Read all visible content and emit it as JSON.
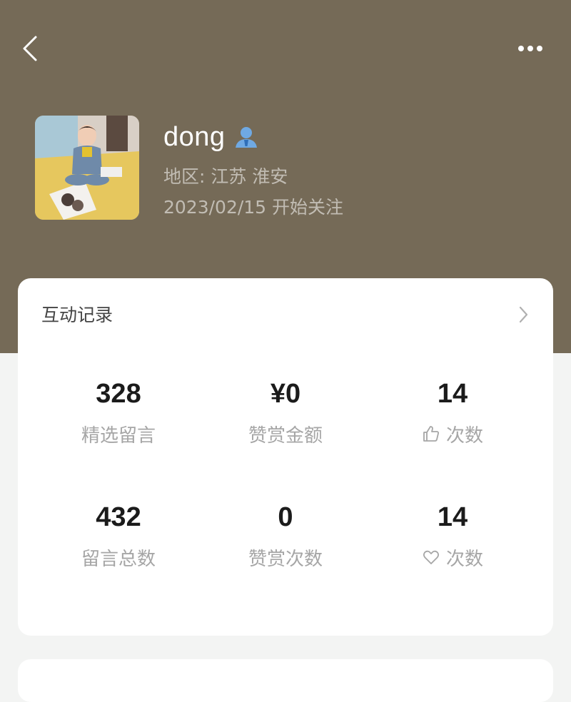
{
  "header": {
    "back_icon": "chevron-left-icon",
    "more_icon": "more-dots-icon",
    "background_color": "#756a57"
  },
  "profile": {
    "name": "dong",
    "verified_icon": "user-badge-icon",
    "region": "地区: 江苏 淮安",
    "follow_since": "2023/02/15 开始关注"
  },
  "interaction_card": {
    "title": "互动记录",
    "chevron_icon": "chevron-right-icon",
    "stats": [
      {
        "value": "328",
        "label": "精选留言"
      },
      {
        "value": "¥0",
        "label": "赞赏金额"
      },
      {
        "value": "14",
        "label": "次数",
        "icon": "thumbs-up-icon"
      },
      {
        "value": "432",
        "label": "留言总数"
      },
      {
        "value": "0",
        "label": "赞赏次数"
      },
      {
        "value": "14",
        "label": "次数",
        "icon": "heart-icon"
      }
    ]
  }
}
